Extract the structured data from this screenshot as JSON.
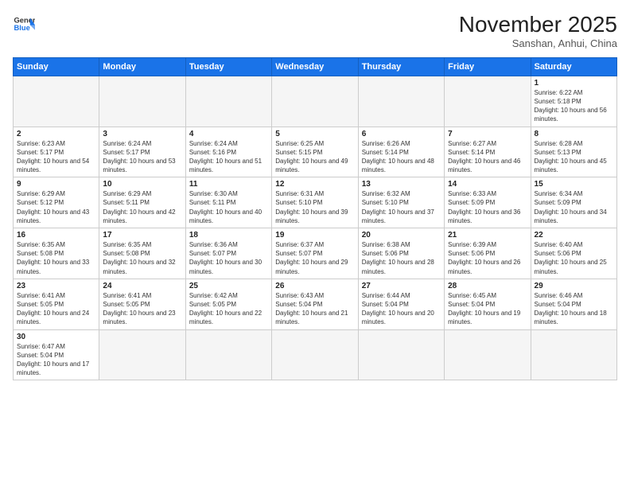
{
  "header": {
    "logo_line1": "General",
    "logo_line2": "Blue",
    "month_title": "November 2025",
    "subtitle": "Sanshan, Anhui, China"
  },
  "weekdays": [
    "Sunday",
    "Monday",
    "Tuesday",
    "Wednesday",
    "Thursday",
    "Friday",
    "Saturday"
  ],
  "weeks": [
    [
      {
        "day": "",
        "empty": true
      },
      {
        "day": "",
        "empty": true
      },
      {
        "day": "",
        "empty": true
      },
      {
        "day": "",
        "empty": true
      },
      {
        "day": "",
        "empty": true
      },
      {
        "day": "",
        "empty": true
      },
      {
        "day": "1",
        "sunrise": "6:22 AM",
        "sunset": "5:18 PM",
        "daylight": "10 hours and 56 minutes."
      }
    ],
    [
      {
        "day": "2",
        "sunrise": "6:23 AM",
        "sunset": "5:17 PM",
        "daylight": "10 hours and 54 minutes."
      },
      {
        "day": "3",
        "sunrise": "6:24 AM",
        "sunset": "5:17 PM",
        "daylight": "10 hours and 53 minutes."
      },
      {
        "day": "4",
        "sunrise": "6:24 AM",
        "sunset": "5:16 PM",
        "daylight": "10 hours and 51 minutes."
      },
      {
        "day": "5",
        "sunrise": "6:25 AM",
        "sunset": "5:15 PM",
        "daylight": "10 hours and 49 minutes."
      },
      {
        "day": "6",
        "sunrise": "6:26 AM",
        "sunset": "5:14 PM",
        "daylight": "10 hours and 48 minutes."
      },
      {
        "day": "7",
        "sunrise": "6:27 AM",
        "sunset": "5:14 PM",
        "daylight": "10 hours and 46 minutes."
      },
      {
        "day": "8",
        "sunrise": "6:28 AM",
        "sunset": "5:13 PM",
        "daylight": "10 hours and 45 minutes."
      }
    ],
    [
      {
        "day": "9",
        "sunrise": "6:29 AM",
        "sunset": "5:12 PM",
        "daylight": "10 hours and 43 minutes."
      },
      {
        "day": "10",
        "sunrise": "6:29 AM",
        "sunset": "5:11 PM",
        "daylight": "10 hours and 42 minutes."
      },
      {
        "day": "11",
        "sunrise": "6:30 AM",
        "sunset": "5:11 PM",
        "daylight": "10 hours and 40 minutes."
      },
      {
        "day": "12",
        "sunrise": "6:31 AM",
        "sunset": "5:10 PM",
        "daylight": "10 hours and 39 minutes."
      },
      {
        "day": "13",
        "sunrise": "6:32 AM",
        "sunset": "5:10 PM",
        "daylight": "10 hours and 37 minutes."
      },
      {
        "day": "14",
        "sunrise": "6:33 AM",
        "sunset": "5:09 PM",
        "daylight": "10 hours and 36 minutes."
      },
      {
        "day": "15",
        "sunrise": "6:34 AM",
        "sunset": "5:09 PM",
        "daylight": "10 hours and 34 minutes."
      }
    ],
    [
      {
        "day": "16",
        "sunrise": "6:35 AM",
        "sunset": "5:08 PM",
        "daylight": "10 hours and 33 minutes."
      },
      {
        "day": "17",
        "sunrise": "6:35 AM",
        "sunset": "5:08 PM",
        "daylight": "10 hours and 32 minutes."
      },
      {
        "day": "18",
        "sunrise": "6:36 AM",
        "sunset": "5:07 PM",
        "daylight": "10 hours and 30 minutes."
      },
      {
        "day": "19",
        "sunrise": "6:37 AM",
        "sunset": "5:07 PM",
        "daylight": "10 hours and 29 minutes."
      },
      {
        "day": "20",
        "sunrise": "6:38 AM",
        "sunset": "5:06 PM",
        "daylight": "10 hours and 28 minutes."
      },
      {
        "day": "21",
        "sunrise": "6:39 AM",
        "sunset": "5:06 PM",
        "daylight": "10 hours and 26 minutes."
      },
      {
        "day": "22",
        "sunrise": "6:40 AM",
        "sunset": "5:06 PM",
        "daylight": "10 hours and 25 minutes."
      }
    ],
    [
      {
        "day": "23",
        "sunrise": "6:41 AM",
        "sunset": "5:05 PM",
        "daylight": "10 hours and 24 minutes."
      },
      {
        "day": "24",
        "sunrise": "6:41 AM",
        "sunset": "5:05 PM",
        "daylight": "10 hours and 23 minutes."
      },
      {
        "day": "25",
        "sunrise": "6:42 AM",
        "sunset": "5:05 PM",
        "daylight": "10 hours and 22 minutes."
      },
      {
        "day": "26",
        "sunrise": "6:43 AM",
        "sunset": "5:04 PM",
        "daylight": "10 hours and 21 minutes."
      },
      {
        "day": "27",
        "sunrise": "6:44 AM",
        "sunset": "5:04 PM",
        "daylight": "10 hours and 20 minutes."
      },
      {
        "day": "28",
        "sunrise": "6:45 AM",
        "sunset": "5:04 PM",
        "daylight": "10 hours and 19 minutes."
      },
      {
        "day": "29",
        "sunrise": "6:46 AM",
        "sunset": "5:04 PM",
        "daylight": "10 hours and 18 minutes."
      }
    ],
    [
      {
        "day": "30",
        "sunrise": "6:47 AM",
        "sunset": "5:04 PM",
        "daylight": "10 hours and 17 minutes."
      },
      {
        "day": "",
        "empty": true
      },
      {
        "day": "",
        "empty": true
      },
      {
        "day": "",
        "empty": true
      },
      {
        "day": "",
        "empty": true
      },
      {
        "day": "",
        "empty": true
      },
      {
        "day": "",
        "empty": true
      }
    ]
  ]
}
